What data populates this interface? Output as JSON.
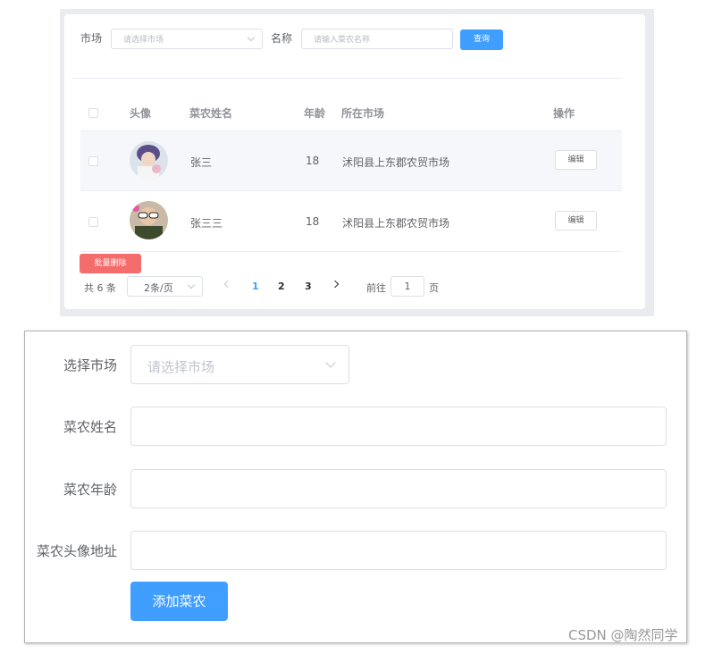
{
  "filter": {
    "market_label": "市场",
    "market_placeholder": "请选择市场",
    "name_label": "名称",
    "name_placeholder": "请输入菜农名称",
    "query_button": "查询"
  },
  "table": {
    "headers": [
      "头像",
      "菜农姓名",
      "年龄",
      "所在市场",
      "操作"
    ],
    "rows": [
      {
        "name": "张三",
        "age": "18",
        "market": "沭阳县上东郡农贸市场",
        "edit": "编辑"
      },
      {
        "name": "张三三",
        "age": "18",
        "market": "沭阳县上东郡农贸市场",
        "edit": "编辑"
      }
    ]
  },
  "batch_delete": "批量删除",
  "pagination": {
    "total": "共 6 条",
    "page_size": "2条/页",
    "pages": [
      "1",
      "2",
      "3"
    ],
    "current_page": "1",
    "goto_prefix": "前往",
    "goto_value": "1",
    "goto_suffix": "页"
  },
  "form": {
    "market_label": "选择市场",
    "market_placeholder": "请选择市场",
    "name_label": "菜农姓名",
    "age_label": "菜农年龄",
    "avatar_label": "菜农头像地址",
    "submit_button": "添加菜农"
  },
  "watermark": "CSDN @陶然同学",
  "colors": {
    "primary": "#409eff",
    "danger": "#f56c6c",
    "border": "#dcdfe6"
  }
}
